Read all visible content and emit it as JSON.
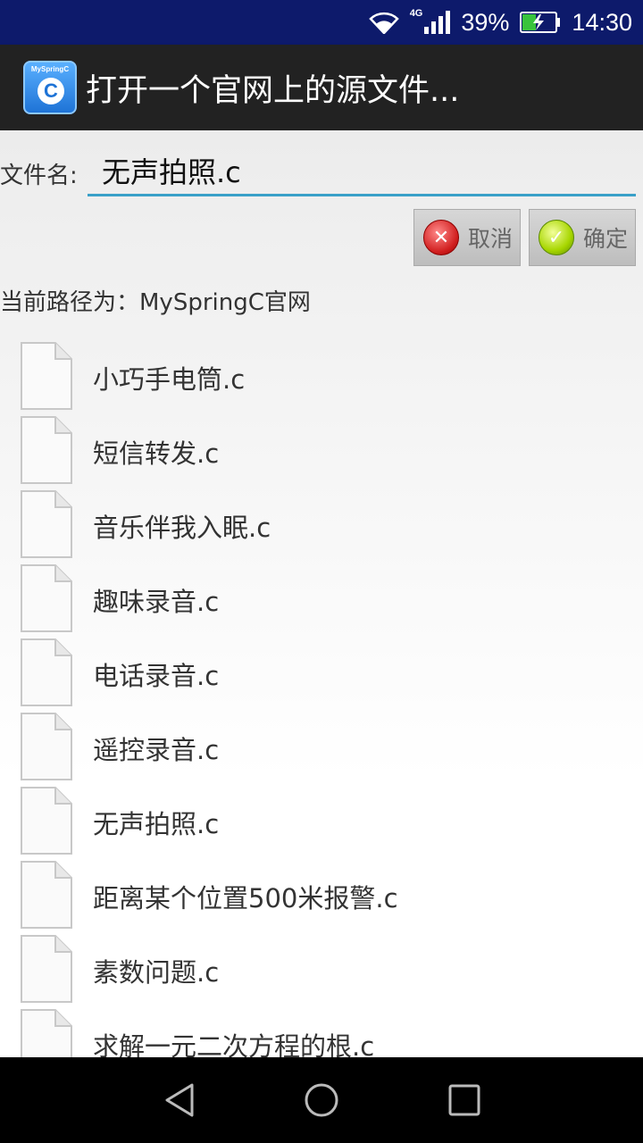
{
  "status_bar": {
    "network": "4G",
    "battery": "39%",
    "time": "14:30"
  },
  "app": {
    "icon_brand": "MySpringC",
    "icon_letter": "C",
    "title": "打开一个官网上的源文件..."
  },
  "dialog": {
    "filename_label": "文件名:",
    "filename_value": "无声拍照.c",
    "cancel_label": "取消",
    "ok_label": "确定",
    "current_path": "当前路径为：MySpringC官网",
    "files": [
      "小巧手电筒.c",
      "短信转发.c",
      "音乐伴我入眠.c",
      "趣味录音.c",
      "电话录音.c",
      "遥控录音.c",
      "无声拍照.c",
      "距离某个位置500米报警.c",
      "素数问题.c",
      "求解一元二次方程的根.c"
    ]
  },
  "icons": {
    "wifi": "wifi-icon",
    "signal": "signal-icon",
    "battery": "battery-charging-icon",
    "file": "file-icon",
    "cancel": "cancel-x-icon",
    "ok": "check-icon",
    "back": "back-triangle-icon",
    "home": "home-circle-icon",
    "recents": "recents-square-icon"
  }
}
